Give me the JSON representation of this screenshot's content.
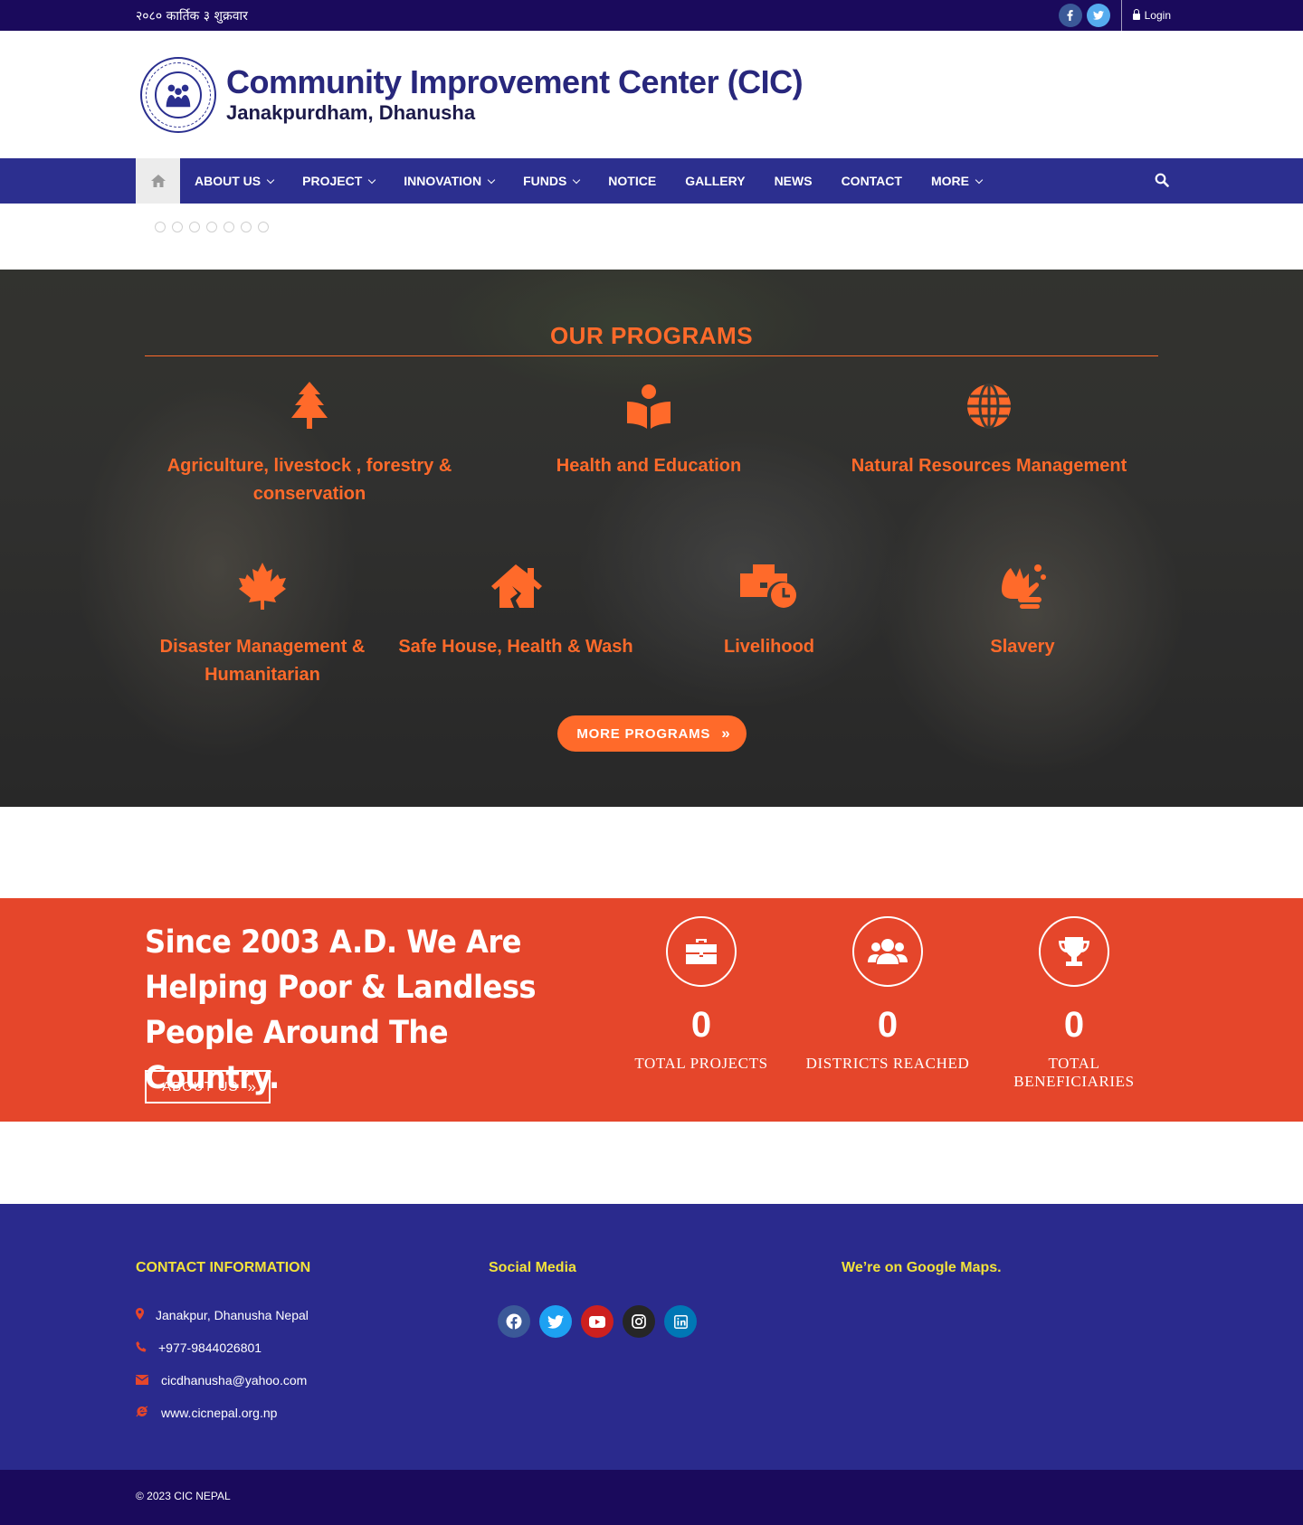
{
  "topbar": {
    "date": "२०८० कार्तिक ३ शुक्रवार",
    "login": "Login",
    "social": [
      "facebook-icon",
      "twitter-icon"
    ]
  },
  "header": {
    "title": "Community Improvement Center (CIC)",
    "subtitle": "Janakpurdham, Dhanusha"
  },
  "nav": {
    "items": [
      {
        "label": "ABOUT US",
        "dropdown": true
      },
      {
        "label": "PROJECT",
        "dropdown": true
      },
      {
        "label": "INNOVATION",
        "dropdown": true
      },
      {
        "label": "FUNDS",
        "dropdown": true
      },
      {
        "label": "NOTICE",
        "dropdown": false
      },
      {
        "label": "GALLERY",
        "dropdown": false
      },
      {
        "label": "NEWS",
        "dropdown": false
      },
      {
        "label": "CONTACT",
        "dropdown": false
      },
      {
        "label": "MORE",
        "dropdown": true
      }
    ]
  },
  "slider": {
    "dot_count": 7
  },
  "programs": {
    "title": "OUR PROGRAMS",
    "items": [
      {
        "label": "Agriculture, livestock , forestry & conservation",
        "icon": "tree-icon"
      },
      {
        "label": "Health and Education",
        "icon": "book-reader-icon"
      },
      {
        "label": "Natural Resources Management",
        "icon": "globe-icon"
      },
      {
        "label": "Disaster Management & Humanitarian",
        "icon": "maple-leaf-icon"
      },
      {
        "label": "Safe House, Health & Wash",
        "icon": "house-damage-icon"
      },
      {
        "label": "Livelihood",
        "icon": "business-time-icon"
      },
      {
        "label": "Slavery",
        "icon": "hands-wash-icon"
      }
    ],
    "more_button": "MORE PROGRAMS"
  },
  "stats": {
    "tagline": "Since 2003 A.D. We Are Helping Poor & Landless People Around The Country.",
    "about_button": "ABOUT US",
    "items": [
      {
        "value": "0",
        "label": "TOTAL PROJECTS",
        "icon": "briefcase-icon"
      },
      {
        "value": "0",
        "label": "DISTRICTS REACHED",
        "icon": "users-icon"
      },
      {
        "value": "0",
        "label": "TOTAL BENEFICIARIES",
        "icon": "trophy-icon"
      }
    ]
  },
  "footer": {
    "contact": {
      "heading": "CONTACT INFORMATION",
      "address": "Janakpur, Dhanusha Nepal",
      "phone": "+977-9844026801",
      "email": "cicdhanusha@yahoo.com",
      "website": "www.cicnepal.org.np"
    },
    "social": {
      "heading": "Social Media",
      "icons": [
        "facebook-icon",
        "twitter-icon",
        "youtube-icon",
        "instagram-icon",
        "linkedin-icon"
      ]
    },
    "maps": {
      "heading": "We’re on Google Maps."
    },
    "copyright": "© 2023 CIC NEPAL"
  },
  "colors": {
    "topbar": "#1a0a5c",
    "nav": "#2c2f8f",
    "accent": "#ff6a2a",
    "stats_bg": "#e5462b",
    "footer": "#2a2a8d",
    "footer_heading": "#f2e23b"
  }
}
